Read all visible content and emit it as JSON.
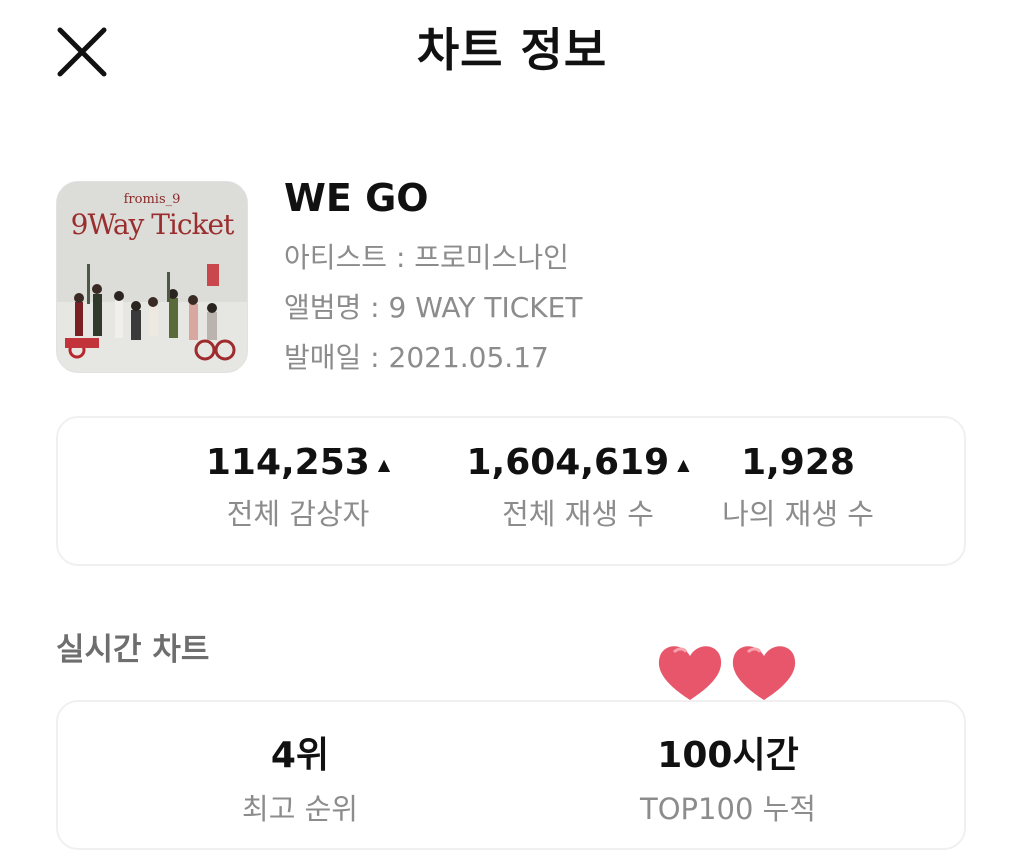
{
  "header": {
    "title": "차트 정보",
    "close_icon": "close-icon"
  },
  "song": {
    "title": "WE GO",
    "artist_line": "아티스트 : 프로미스나인",
    "album_line": "앨범명 : 9 WAY TICKET",
    "release_line": "발매일 : 2021.05.17",
    "cover": {
      "artist_text": "fromis_9",
      "title_text": "9Way Ticket"
    }
  },
  "stats": [
    {
      "value": "114,253",
      "label": "전체 감상자",
      "trend": "▲"
    },
    {
      "value": "1,604,619",
      "label": "전체 재생 수",
      "trend": "▲"
    },
    {
      "value": "1,928",
      "label": "나의 재생 수"
    }
  ],
  "realtime": {
    "section_title": "실시간 차트",
    "items": [
      {
        "value": "4위",
        "label": "최고 순위"
      },
      {
        "value": "100시간",
        "label": "TOP100 누적"
      }
    ],
    "decoration": "hearts-sticker",
    "heart_color": "#e8566b"
  }
}
